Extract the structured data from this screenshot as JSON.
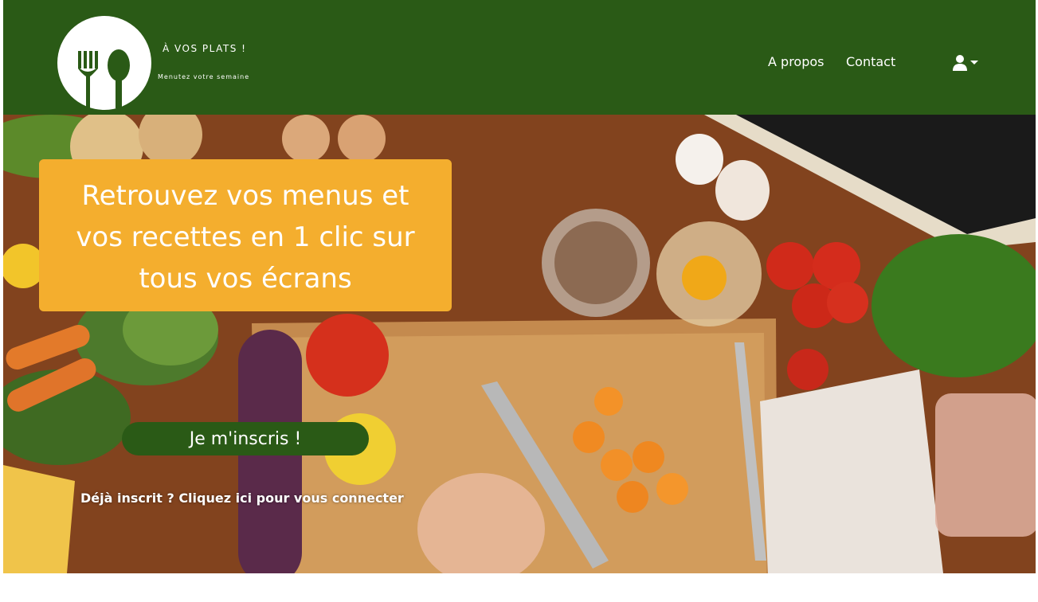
{
  "navbar": {
    "brand_title": "À VOS PLATS !",
    "brand_tagline": "Menutez votre semaine",
    "logo_icon": "fork-spoon-icon",
    "links": [
      {
        "label": "A propos"
      },
      {
        "label": "Contact"
      }
    ],
    "user_menu_icon": "user-icon",
    "user_menu_caret": "caret-down-icon",
    "background_color": "#2a5a16"
  },
  "hero": {
    "headline": "Retrouvez vos menus et vos recettes en 1 clic sur tous vos écrans",
    "card_color": "#f4ae2e",
    "signup_label": "Je m'inscris !",
    "login_label": "Déjà inscrit ? Cliquez ici pour vous connecter",
    "image_description": "kitchen-countertop-vegetables"
  }
}
